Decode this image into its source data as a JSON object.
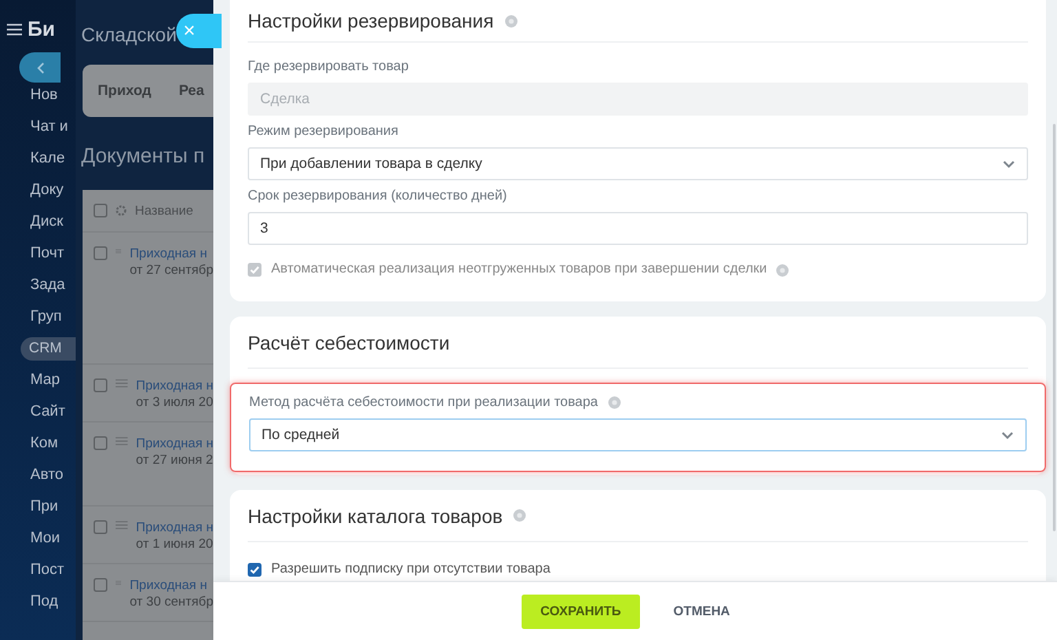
{
  "sidebar": {
    "title": "Би",
    "items": [
      {
        "label": "Нов",
        "kind": "link"
      },
      {
        "label": "Чат и",
        "kind": "link"
      },
      {
        "label": "Кале",
        "kind": "link"
      },
      {
        "label": "Доку",
        "kind": "link"
      },
      {
        "label": "Диск",
        "kind": "link"
      },
      {
        "label": "Почт",
        "kind": "link"
      },
      {
        "label": "Зада",
        "kind": "link"
      },
      {
        "label": "Груп",
        "kind": "link"
      },
      {
        "label": "CRM",
        "kind": "group"
      },
      {
        "label": "Мар",
        "kind": "link"
      },
      {
        "label": "Сайт",
        "kind": "link"
      },
      {
        "label": "Ком",
        "kind": "link"
      },
      {
        "label": "Авто",
        "kind": "link"
      },
      {
        "label": "При",
        "kind": "link"
      },
      {
        "label": "Мои",
        "kind": "link"
      },
      {
        "label": "Пост",
        "kind": "link"
      },
      {
        "label": "Под",
        "kind": "link"
      }
    ]
  },
  "background_page": {
    "title": "Складской",
    "tabs": [
      "Приход",
      "Реа"
    ],
    "heading": "Документы п",
    "table": {
      "all_checked": false,
      "columns": [
        "Название"
      ],
      "rows": [
        {
          "name": "Приходная н",
          "date": "от 27 сентябр",
          "checked": false
        },
        {
          "name": "Приходная н",
          "date": "от 3 июля 20",
          "checked": false
        },
        {
          "name": "Приходная н",
          "date": "от 27 июня 2",
          "checked": false
        },
        {
          "name": "Приходная н",
          "date": "от 1 июня 20",
          "checked": false
        },
        {
          "name": "Приходная н",
          "date": "от 30 сентябр",
          "checked": false
        }
      ]
    }
  },
  "close_button": {
    "label": "×"
  },
  "sections": [
    {
      "title": "Настройки резервирования",
      "help": true,
      "fields": [
        {
          "kind": "input",
          "label": "Где резервировать товар",
          "value": "Сделка",
          "disabled": true
        },
        {
          "kind": "select",
          "label": "Режим резервирования",
          "value": "При добавлении товара в сделку",
          "disabled": false
        },
        {
          "kind": "input",
          "label": "Срок резервирования (количество дней)",
          "value": "3",
          "disabled": false
        },
        {
          "kind": "checkbox",
          "label": "Автоматическая реализация неотгруженных товаров при завершении сделки",
          "checked": true,
          "disabled": true,
          "help": true
        }
      ]
    },
    {
      "title": "Расчёт себестоимости",
      "highlighted": true,
      "fields": [
        {
          "kind": "select",
          "label": "Метод расчёта себестоимости при реализации товара",
          "value": "По средней",
          "disabled": false,
          "help": true,
          "focused": true
        }
      ]
    },
    {
      "title": "Настройки каталога товаров",
      "help": true,
      "fields": [
        {
          "kind": "checkbox",
          "label": "Разрешить подписку при отсутствии товара",
          "checked": true,
          "disabled": false
        }
      ]
    }
  ],
  "footer": {
    "buttons": [
      {
        "label": "СОХРАНИТЬ",
        "kind": "primary"
      },
      {
        "label": "ОТМЕНА",
        "kind": "link"
      }
    ]
  }
}
